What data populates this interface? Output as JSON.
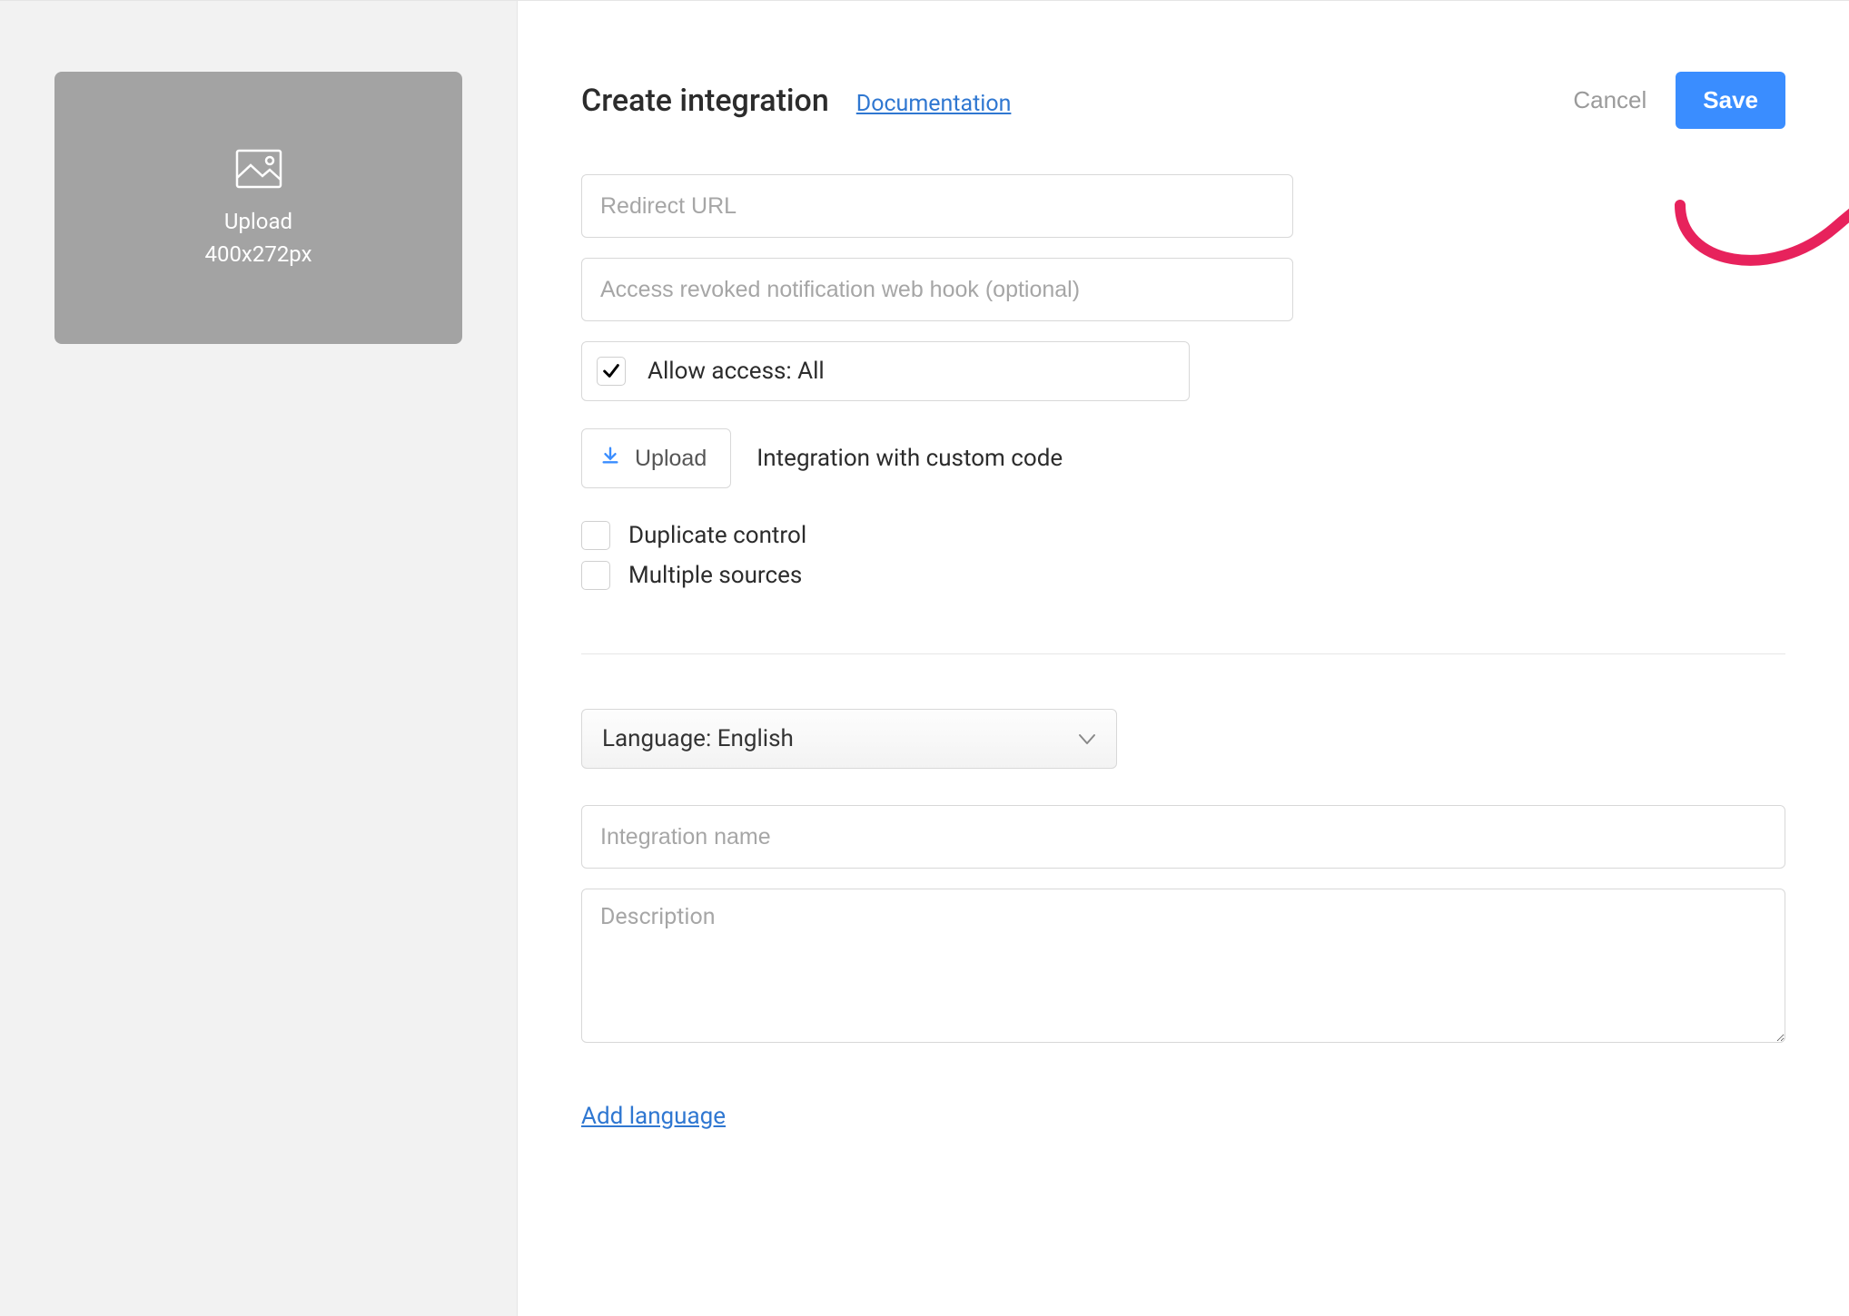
{
  "sidebar": {
    "upload_label": "Upload",
    "upload_hint": "400x272px"
  },
  "header": {
    "title": "Create integration",
    "documentation_link": "Documentation",
    "cancel_label": "Cancel",
    "save_label": "Save"
  },
  "form": {
    "redirect_url_placeholder": "Redirect URL",
    "webhook_placeholder": "Access revoked notification web hook (optional)",
    "allow_access_label": "Allow access: All",
    "upload_button_label": "Upload",
    "upload_desc": "Integration with custom code",
    "duplicate_control_label": "Duplicate control",
    "multiple_sources_label": "Multiple sources"
  },
  "locale": {
    "language_select_label": "Language: English",
    "integration_name_placeholder": "Integration name",
    "description_placeholder": "Description",
    "add_language_label": "Add language"
  },
  "colors": {
    "accent": "#3a8dff",
    "link": "#2f77d1",
    "annotation": "#e7225c"
  }
}
